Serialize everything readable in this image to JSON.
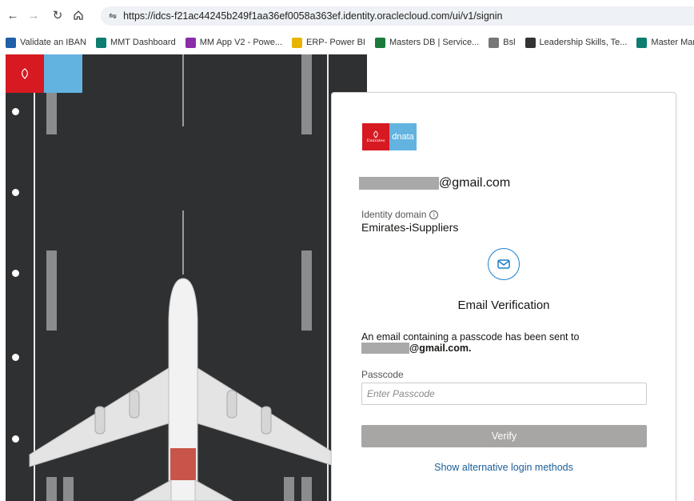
{
  "browser": {
    "url": "https://idcs-f21ac44245b249f1aa36ef0058a363ef.identity.oraclecloud.com/ui/v1/signin",
    "bookmarks": [
      {
        "label": "Validate an IBAN",
        "icon": "iban-icon",
        "color": "#1f5fa8"
      },
      {
        "label": "MMT Dashboard",
        "icon": "ai-builder-icon",
        "color": "#0d7d6f"
      },
      {
        "label": "MM App V2 - Powe...",
        "icon": "power-apps-icon",
        "color": "#8a2da8"
      },
      {
        "label": "ERP- Power BI",
        "icon": "power-bi-icon",
        "color": "#e8b400"
      },
      {
        "label": "Masters DB | Service...",
        "icon": "service-icon",
        "color": "#1b7a3c"
      },
      {
        "label": "Bsl",
        "icon": "globe-icon",
        "color": "#777777"
      },
      {
        "label": "Leadership Skills, Te...",
        "icon": "leadership-icon",
        "color": "#333333"
      },
      {
        "label": "Master Managemen...",
        "icon": "ai-builder-icon",
        "color": "#0d7d6f"
      }
    ]
  },
  "brand": {
    "emirates": "Emirates",
    "dnata": "dnata"
  },
  "card": {
    "email_suffix": "@gmail.com",
    "domain_label": "Identity domain",
    "domain_value": "Emirates-iSuppliers",
    "title": "Email Verification",
    "sent_text": "An email containing a passcode has been sent to",
    "sent_email_suffix": "@gmail.com.",
    "passcode_label": "Passcode",
    "passcode_placeholder": "Enter Passcode",
    "verify_label": "Verify",
    "alt_link": "Show alternative login methods"
  },
  "colors": {
    "emirates_red": "#d71921",
    "dnata_blue": "#62b3e0",
    "link_blue": "#1b5e99",
    "button_gray": "#a7a6a4"
  }
}
